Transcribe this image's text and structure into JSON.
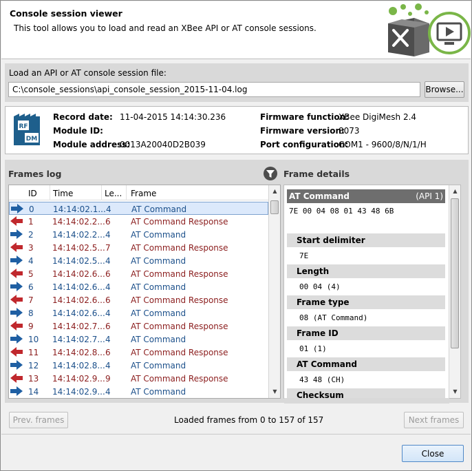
{
  "header": {
    "title": "Console session viewer",
    "description": "This tool allows you to load and read an XBee API or AT console sessions."
  },
  "load": {
    "label": "Load an API or AT console session file:",
    "path": "C:\\console_sessions\\api_console_session_2015-11-04.log",
    "browse_label": "Browse..."
  },
  "module": {
    "icon_top": "RF",
    "icon_bottom": "DM",
    "record_date_label": "Record date:",
    "record_date": "11-04-2015 14:14:30.236",
    "module_id_label": "Module ID:",
    "module_id": "",
    "module_address_label": "Module address:",
    "module_address": "0013A20040D2B039",
    "firmware_function_label": "Firmware function:",
    "firmware_function": "XBee DigiMesh 2.4",
    "firmware_version_label": "Firmware version:",
    "firmware_version": "8073",
    "port_configuration_label": "Port configuration:",
    "port_configuration": "COM1 - 9600/8/N/1/H"
  },
  "frames_log": {
    "title": "Frames log",
    "columns": [
      "ID",
      "Time",
      "Le...",
      "Frame"
    ],
    "rows": [
      {
        "dir": "out",
        "id": "0",
        "time": "14:14:02.1...",
        "len": "4",
        "frame": "AT Command"
      },
      {
        "dir": "in",
        "id": "1",
        "time": "14:14:02.2...",
        "len": "6",
        "frame": "AT Command Response"
      },
      {
        "dir": "out",
        "id": "2",
        "time": "14:14:02.2...",
        "len": "4",
        "frame": "AT Command"
      },
      {
        "dir": "in",
        "id": "3",
        "time": "14:14:02.5...",
        "len": "7",
        "frame": "AT Command Response"
      },
      {
        "dir": "out",
        "id": "4",
        "time": "14:14:02.5...",
        "len": "4",
        "frame": "AT Command"
      },
      {
        "dir": "in",
        "id": "5",
        "time": "14:14:02.6...",
        "len": "6",
        "frame": "AT Command Response"
      },
      {
        "dir": "out",
        "id": "6",
        "time": "14:14:02.6...",
        "len": "4",
        "frame": "AT Command"
      },
      {
        "dir": "in",
        "id": "7",
        "time": "14:14:02.6...",
        "len": "6",
        "frame": "AT Command Response"
      },
      {
        "dir": "out",
        "id": "8",
        "time": "14:14:02.6...",
        "len": "4",
        "frame": "AT Command"
      },
      {
        "dir": "in",
        "id": "9",
        "time": "14:14:02.7...",
        "len": "6",
        "frame": "AT Command Response"
      },
      {
        "dir": "out",
        "id": "10",
        "time": "14:14:02.7...",
        "len": "4",
        "frame": "AT Command"
      },
      {
        "dir": "in",
        "id": "11",
        "time": "14:14:02.8...",
        "len": "6",
        "frame": "AT Command Response"
      },
      {
        "dir": "out",
        "id": "12",
        "time": "14:14:02.8...",
        "len": "4",
        "frame": "AT Command"
      },
      {
        "dir": "in",
        "id": "13",
        "time": "14:14:02.9...",
        "len": "9",
        "frame": "AT Command Response"
      },
      {
        "dir": "out",
        "id": "14",
        "time": "14:14:02.9...",
        "len": "4",
        "frame": "AT Command"
      }
    ]
  },
  "frame_details": {
    "title": "Frame details",
    "frame_name": "AT Command",
    "frame_api": "(API 1)",
    "raw": "7E 00 04 08 01 43 48 6B",
    "sections": [
      {
        "label": "Start delimiter",
        "value": "7E"
      },
      {
        "label": "Length",
        "value": "00 04 (4)"
      },
      {
        "label": "Frame type",
        "value": "08 (AT Command)"
      },
      {
        "label": "Frame ID",
        "value": "01 (1)"
      },
      {
        "label": "AT Command",
        "value": "43 48 (CH)"
      },
      {
        "label": "Checksum",
        "value": ""
      }
    ]
  },
  "navigation": {
    "prev_label": "Prev. frames",
    "status": "Loaded frames from 0 to 157 of 157",
    "next_label": "Next frames"
  },
  "close_label": "Close",
  "colors": {
    "sent_arrow": "#1f5fa3",
    "received_arrow": "#c0282d",
    "logo_green": "#7ab648",
    "logo_dark": "#4d4d4d"
  }
}
